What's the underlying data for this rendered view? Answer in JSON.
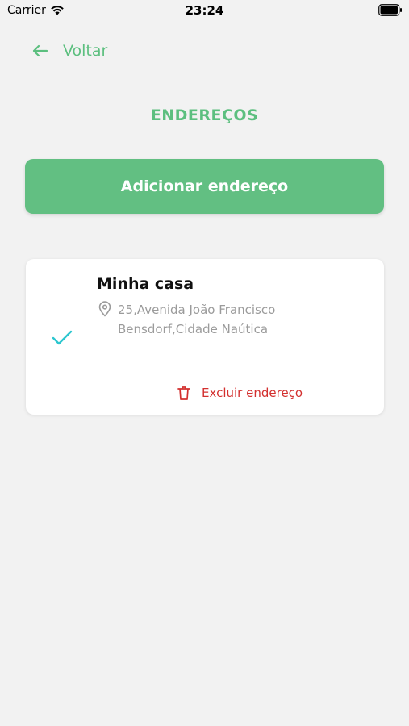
{
  "status_bar": {
    "carrier": "Carrier",
    "time": "23:24"
  },
  "header": {
    "back_label": "Voltar",
    "title": "ENDEREÇOS"
  },
  "actions": {
    "add_address_label": "Adicionar endereço"
  },
  "addresses": [
    {
      "name": "Minha casa",
      "line1": "25,Avenida João Francisco",
      "line2": "Bensdorf,Cidade Naútica",
      "selected": true,
      "delete_label": "Excluir endereço"
    }
  ],
  "colors": {
    "accent": "#5cbf7f",
    "button": "#62bf82",
    "check": "#2cc6cf",
    "danger": "#d3302f",
    "background": "#f2f2f2"
  },
  "icons": {
    "back": "back-arrow-icon",
    "selected": "check-icon",
    "location": "pin-icon",
    "delete": "trash-icon"
  }
}
